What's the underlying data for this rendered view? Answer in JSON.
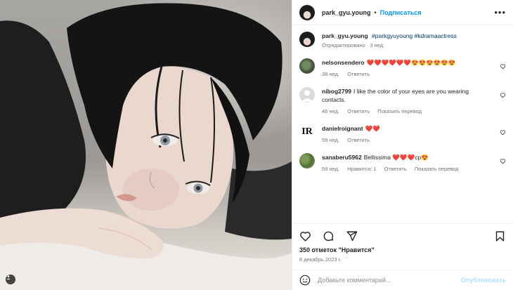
{
  "post": {
    "author": "park_gyu.young",
    "follow_label": "Подписаться",
    "dot": "•",
    "more_label": "•••",
    "caption_author": "park_gyu.young",
    "caption_tags": "#parkgyuyoung #kdramaactress",
    "caption_meta": "Отредактировано · 3 нед.",
    "likes": "350 отметок \"Нравится\"",
    "date": "8 декабрь 2023 г.",
    "comment_placeholder": "Добавьте комментарий...",
    "publish_label": "Опубликовать"
  },
  "comments": [
    {
      "user": "nelsonsendero",
      "text": "❤️❤️❤️❤️❤️❤️😍😍😍😍😍😍",
      "age": "38 нед.",
      "reply": "Ответить",
      "likes": "",
      "translate": ""
    },
    {
      "user": "nibog2799",
      "text": "I like the color of your eyes are you wearing contacts.",
      "age": "46 нед.",
      "reply": "Ответить",
      "likes": "",
      "translate": "Показать перевод"
    },
    {
      "user": "danielroignant",
      "text": "❤️❤️",
      "age": "59 нед.",
      "reply": "Ответить",
      "likes": "",
      "translate": ""
    },
    {
      "user": "sanaberu5962",
      "text": "Bellissima ❤️❤️❤️cp😍",
      "age": "59 нед.",
      "reply": "Ответить",
      "likes": "Нравится: 1",
      "translate": "Показать перевод"
    }
  ],
  "icons": {
    "heart": "heart-icon",
    "comment": "comment-icon",
    "share": "share-icon",
    "save": "bookmark-icon",
    "emoji": "emoji-icon",
    "more": "more-icon",
    "tag": "person-tag-icon"
  },
  "colors": {
    "accent": "#0095f6",
    "text": "#262626",
    "muted": "#737373",
    "tag_link": "#00376b",
    "publish_disabled": "#b2dffc"
  }
}
